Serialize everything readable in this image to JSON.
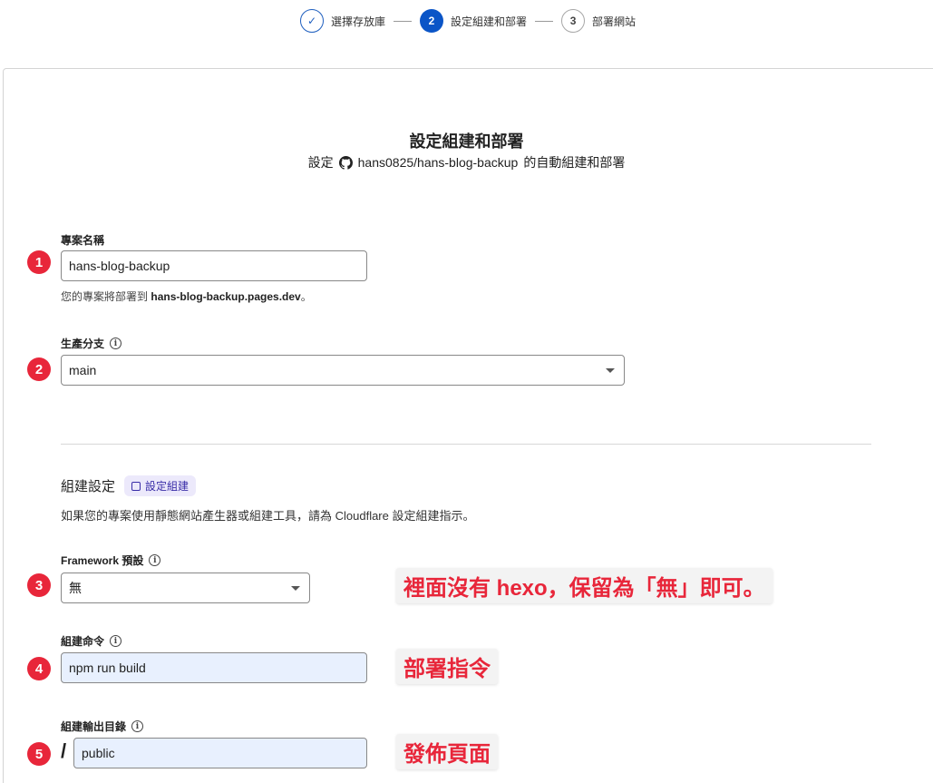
{
  "stepper": {
    "steps": [
      {
        "num": "✓",
        "label": "選擇存放庫"
      },
      {
        "num": "2",
        "label": "設定組建和部署"
      },
      {
        "num": "3",
        "label": "部署網站"
      }
    ]
  },
  "header": {
    "title": "設定組建和部署",
    "subtitle_prefix": "設定",
    "repo": "hans0825/hans-blog-backup",
    "subtitle_suffix": "的自動組建和部署"
  },
  "project_name": {
    "label": "專案名稱",
    "value": "hans-blog-backup",
    "hint_prefix": "您的專案將部署到",
    "hint_domain": "hans-blog-backup.pages.dev",
    "hint_suffix": "。"
  },
  "production_branch": {
    "label": "生產分支",
    "value": "main"
  },
  "build_settings": {
    "title": "組建設定",
    "doc_link": "設定組建",
    "description": "如果您的專案使用靜態網站產生器或組建工具，請為 Cloudflare 設定組建指示。"
  },
  "framework": {
    "label": "Framework 預設",
    "value": "無"
  },
  "build_command": {
    "label": "組建命令",
    "value": "npm run build"
  },
  "output_dir": {
    "label": "組建輸出目錄",
    "prefix": "/",
    "value": "public"
  },
  "annotations": {
    "badges": [
      "1",
      "2",
      "3",
      "4",
      "5"
    ],
    "note_framework": "裡面沒有 hexo，保留為「無」即可。",
    "note_build": "部署指令",
    "note_output": "發佈頁面",
    "color": "#e8263a"
  },
  "icons": {
    "check": "check-icon",
    "github": "github-icon",
    "info": "info-icon",
    "doc": "doc-icon"
  }
}
